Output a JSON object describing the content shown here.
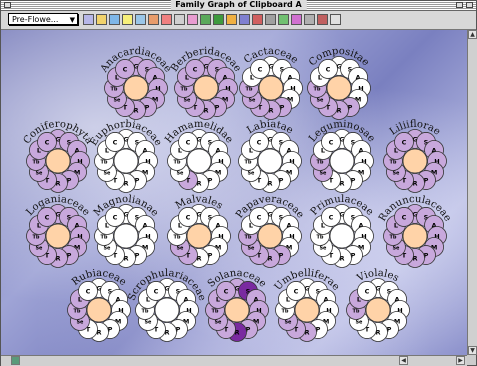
{
  "window": {
    "title": "Family Graph of Clipboard A"
  },
  "toolbar": {
    "filter": {
      "value": "Pre-Flowe..."
    },
    "tool_icons": [
      {
        "name": "grid-icon",
        "color": "#b7b7e8"
      },
      {
        "name": "chart-icon",
        "color": "#f2d36b"
      },
      {
        "name": "globe-icon",
        "color": "#7fb7e8"
      },
      {
        "name": "bulb-icon",
        "color": "#f7f07a"
      },
      {
        "name": "mail-icon",
        "color": "#9ac6e8"
      },
      {
        "name": "picture-icon",
        "color": "#e89c6b"
      },
      {
        "name": "flower-icon",
        "color": "#f08080"
      },
      {
        "name": "search-icon",
        "color": "#d0d0d0"
      },
      {
        "name": "palette-icon",
        "color": "#e89cd0"
      },
      {
        "name": "tree-icon",
        "color": "#5aa95a"
      },
      {
        "name": "plant-icon",
        "color": "#3f9a3f"
      },
      {
        "name": "warning-icon",
        "color": "#f0b040"
      },
      {
        "name": "book-icon",
        "color": "#8080d0"
      },
      {
        "name": "card-icon",
        "color": "#d06060"
      },
      {
        "name": "sort-icon",
        "color": "#a0a0a0"
      },
      {
        "name": "leaf-icon",
        "color": "#70c070"
      },
      {
        "name": "petal-icon",
        "color": "#d070d0"
      },
      {
        "name": "ruler-icon",
        "color": "#b0b0b0"
      },
      {
        "name": "arrows-icon",
        "color": "#c06060"
      },
      {
        "name": "star-icon",
        "color": "#e0e0e0"
      }
    ]
  },
  "petal_labels": [
    "G",
    "S",
    "A",
    "H",
    "M",
    "P",
    "R",
    "T",
    "Se",
    "Tb",
    "L",
    "C"
  ],
  "colors": {
    "lilac": "#c8a8dc",
    "dark_purple": "#7a2aa0",
    "white": "#ffffff",
    "peach": "#ffd3a8",
    "outline": "#333333"
  },
  "families": [
    {
      "name": "Anacardiaceae",
      "row": 0,
      "col": 0,
      "center": "peach",
      "filled": [
        0,
        1,
        2,
        3,
        4,
        5,
        6,
        7,
        8,
        9,
        10,
        11
      ],
      "dark": []
    },
    {
      "name": "Berberidaceae",
      "row": 0,
      "col": 1,
      "center": "peach",
      "filled": [
        0,
        1,
        2,
        3,
        4,
        5,
        6,
        7,
        8,
        9,
        10,
        11
      ],
      "dark": []
    },
    {
      "name": "Cactaceae",
      "row": 0,
      "col": 2,
      "center": "peach",
      "filled": [
        5,
        6,
        7,
        8,
        9
      ],
      "dark": []
    },
    {
      "name": "Compositae",
      "row": 0,
      "col": 3,
      "center": "peach",
      "filled": [
        5,
        6,
        7,
        8,
        9
      ],
      "dark": []
    },
    {
      "name": "Coniferophyta",
      "row": 1,
      "col": 0,
      "center": "peach",
      "filled": [
        0,
        1,
        2,
        3,
        4,
        5,
        6,
        7,
        8,
        9,
        10,
        11
      ],
      "dark": []
    },
    {
      "name": "Euphorbiaceae",
      "row": 1,
      "col": 1,
      "center": "white",
      "filled": [],
      "dark": []
    },
    {
      "name": "Hamamelidae",
      "row": 1,
      "col": 2,
      "center": "white",
      "filled": [
        7
      ],
      "dark": []
    },
    {
      "name": "Labiatae",
      "row": 1,
      "col": 3,
      "center": "white",
      "filled": [],
      "dark": []
    },
    {
      "name": "Leguminosae",
      "row": 1,
      "col": 4,
      "center": "white",
      "filled": [
        8,
        9
      ],
      "dark": []
    },
    {
      "name": "Liliiflorae",
      "row": 1,
      "col": 5,
      "center": "peach",
      "filled": [
        0,
        1,
        2,
        3,
        4,
        5,
        6,
        7,
        8,
        9,
        10,
        11
      ],
      "dark": []
    },
    {
      "name": "Loganiaceae",
      "row": 2,
      "col": 0,
      "center": "peach",
      "filled": [
        0,
        1,
        2,
        3,
        4,
        5,
        6,
        7,
        8,
        9,
        10,
        11
      ],
      "dark": []
    },
    {
      "name": "Magnolianae",
      "row": 2,
      "col": 1,
      "center": "white",
      "filled": [],
      "dark": []
    },
    {
      "name": "Malvales",
      "row": 2,
      "col": 2,
      "center": "peach",
      "filled": [
        7,
        8
      ],
      "dark": []
    },
    {
      "name": "Papaveraceae",
      "row": 2,
      "col": 3,
      "center": "peach",
      "filled": [
        5,
        6,
        7,
        8,
        9
      ],
      "dark": []
    },
    {
      "name": "Primulaceae",
      "row": 2,
      "col": 4,
      "center": "white",
      "filled": [],
      "dark": []
    },
    {
      "name": "Ranunculaceae",
      "row": 2,
      "col": 5,
      "center": "peach",
      "filled": [
        0,
        1,
        2,
        3,
        4,
        5,
        6,
        7,
        8,
        9,
        10,
        11
      ],
      "dark": []
    },
    {
      "name": "Rubiaceae",
      "row": 3,
      "col": 0,
      "center": "peach",
      "filled": [
        8,
        9,
        10
      ],
      "dark": []
    },
    {
      "name": "Scrophulariaceae",
      "row": 3,
      "col": 1,
      "center": "white",
      "filled": [],
      "dark": []
    },
    {
      "name": "Solanaceae",
      "row": 3,
      "col": 2,
      "center": "peach",
      "filled": [
        0,
        1,
        2,
        3,
        4,
        5,
        7,
        8,
        9,
        10,
        11
      ],
      "dark": [
        1,
        6
      ]
    },
    {
      "name": "Umbelliferae",
      "row": 3,
      "col": 3,
      "center": "peach",
      "filled": [
        6,
        7,
        8
      ],
      "dark": []
    },
    {
      "name": "Violales",
      "row": 3,
      "col": 4,
      "center": "peach",
      "filled": [
        9,
        10
      ],
      "dark": []
    }
  ]
}
